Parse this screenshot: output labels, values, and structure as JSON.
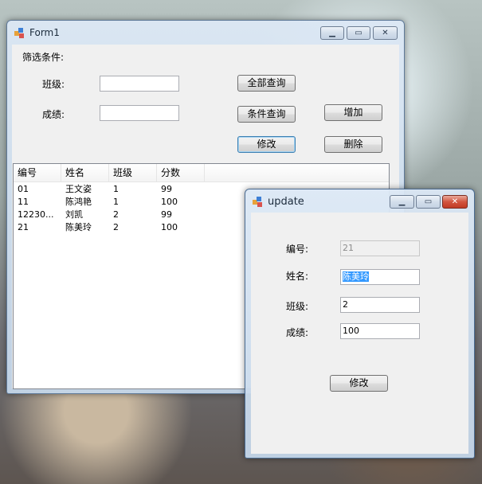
{
  "form1": {
    "title": "Form1",
    "filter_label": "筛选条件:",
    "class_label": "班级:",
    "score_label": "成绩:",
    "class_value": "",
    "score_value": "",
    "buttons": {
      "query_all": "全部查询",
      "query_condition": "条件查询",
      "add": "增加",
      "modify": "修改",
      "delete": "删除"
    },
    "list": {
      "columns": [
        "编号",
        "姓名",
        "班级",
        "分数"
      ],
      "rows": [
        [
          "01",
          "王文姿",
          "1",
          "99"
        ],
        [
          "11",
          "陈鸿艳",
          "1",
          "100"
        ],
        [
          "12230...",
          "刘凯",
          "2",
          "99"
        ],
        [
          "21",
          "陈美玲",
          "2",
          "100"
        ]
      ]
    }
  },
  "update": {
    "title": "update",
    "id_label": "编号:",
    "name_label": "姓名:",
    "class_label": "班级:",
    "score_label": "成绩:",
    "id_value": "21",
    "name_value": "陈美玲",
    "class_value": "2",
    "score_value": "100",
    "modify_button": "修改"
  },
  "caption": {
    "minimize": "▁",
    "maximize": "▭",
    "close": "✕"
  }
}
